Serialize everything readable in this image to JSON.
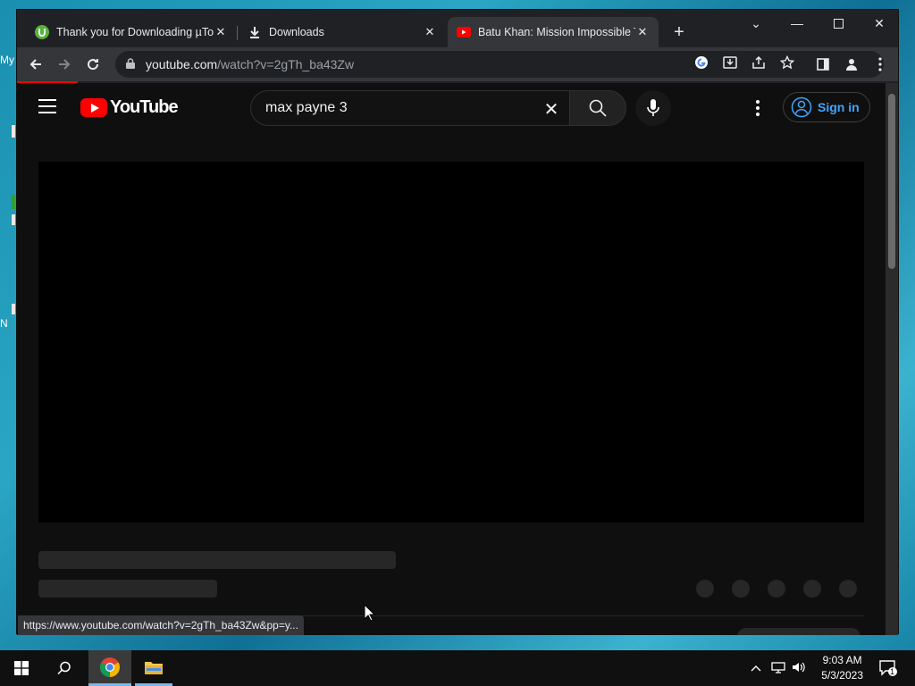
{
  "desktop": {
    "peek_texts": [
      "My",
      "N"
    ]
  },
  "tabs": [
    {
      "title": "Thank you for Downloading µTorrent",
      "favicon": "utorrent-icon",
      "active": false
    },
    {
      "title": "Downloads",
      "favicon": "download-icon",
      "active": false
    },
    {
      "title": "Batu Khan: Mission Impossible Tr...",
      "favicon": "youtube-icon",
      "active": true
    }
  ],
  "omnibox": {
    "host": "youtube.com",
    "path": "/watch?v=2gTh_ba43Zw"
  },
  "youtube": {
    "logo_text": "YouTube",
    "search_value": "max payne 3",
    "search_placeholder": "Search",
    "signin_label": "Sign in"
  },
  "status_url": "https://www.youtube.com/watch?v=2gTh_ba43Zw&pp=y...",
  "taskbar": {
    "time": "9:03 AM",
    "date": "5/3/2023",
    "notification_count": "1"
  },
  "colors": {
    "youtube_red": "#ff0000",
    "link_blue": "#3ea6ff",
    "chrome_dark": "#202124",
    "toolbar": "#35363a"
  }
}
